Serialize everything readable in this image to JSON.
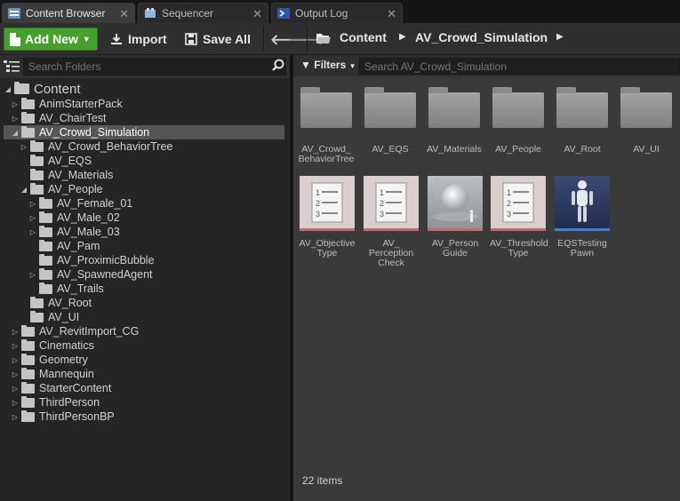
{
  "tabs": [
    {
      "label": "Content Browser"
    },
    {
      "label": "Sequencer"
    },
    {
      "label": "Output Log"
    }
  ],
  "toolbar": {
    "add_new": "Add New",
    "import": "Import",
    "save_all": "Save All"
  },
  "breadcrumb": [
    "Content",
    "AV_Crowd_Simulation"
  ],
  "folder_search": {
    "placeholder": "Search Folders"
  },
  "tree": [
    {
      "label": "Content",
      "expanded": true
    },
    {
      "label": "AnimStarterPack"
    },
    {
      "label": "AV_ChairTest"
    },
    {
      "label": "AV_Crowd_Simulation",
      "selected": true
    },
    {
      "label": "AV_Crowd_BehaviorTree"
    },
    {
      "label": "AV_EQS"
    },
    {
      "label": "AV_Materials"
    },
    {
      "label": "AV_People"
    },
    {
      "label": "AV_Female_01"
    },
    {
      "label": "AV_Male_02"
    },
    {
      "label": "AV_Male_03"
    },
    {
      "label": "AV_Pam"
    },
    {
      "label": "AV_ProximicBubble"
    },
    {
      "label": "AV_SpawnedAgent"
    },
    {
      "label": "AV_Trails"
    },
    {
      "label": "AV_Root"
    },
    {
      "label": "AV_UI"
    },
    {
      "label": "AV_RevitImport_CG"
    },
    {
      "label": "Cinematics"
    },
    {
      "label": "Geometry"
    },
    {
      "label": "Mannequin"
    },
    {
      "label": "StarterContent"
    },
    {
      "label": "ThirdPerson"
    },
    {
      "label": "ThirdPersonBP"
    }
  ],
  "filters_label": "Filters",
  "asset_search": {
    "placeholder": "Search AV_Crowd_Simulation"
  },
  "folder_tiles": [
    {
      "l1": "AV_Crowd_",
      "l2": "BehaviorTree"
    },
    {
      "l1": "AV_EQS",
      "l2": ""
    },
    {
      "l1": "AV_Materials",
      "l2": ""
    },
    {
      "l1": "AV_People",
      "l2": ""
    },
    {
      "l1": "AV_Root",
      "l2": ""
    },
    {
      "l1": "AV_UI",
      "l2": ""
    }
  ],
  "asset_tiles": [
    {
      "l1": "AV_Objective",
      "l2": "Type",
      "l3": "",
      "icon": "enum-list-icon",
      "bar": "#c06a6a"
    },
    {
      "l1": "AV_",
      "l2": "Perception",
      "l3": "Check",
      "icon": "enum-list-icon",
      "bar": "#c06a6a"
    },
    {
      "l1": "AV_Person",
      "l2": "Guide",
      "l3": "",
      "icon": "sphere-icon",
      "bar": "#c06a6a"
    },
    {
      "l1": "AV_Threshold",
      "l2": "Type",
      "l3": "",
      "icon": "enum-list-icon",
      "bar": "#c06a6a"
    },
    {
      "l1": "EQSTesting",
      "l2": "Pawn",
      "l3": "",
      "icon": "mannequin-icon",
      "bar": "#3f7fd6"
    }
  ],
  "status": "22 items"
}
